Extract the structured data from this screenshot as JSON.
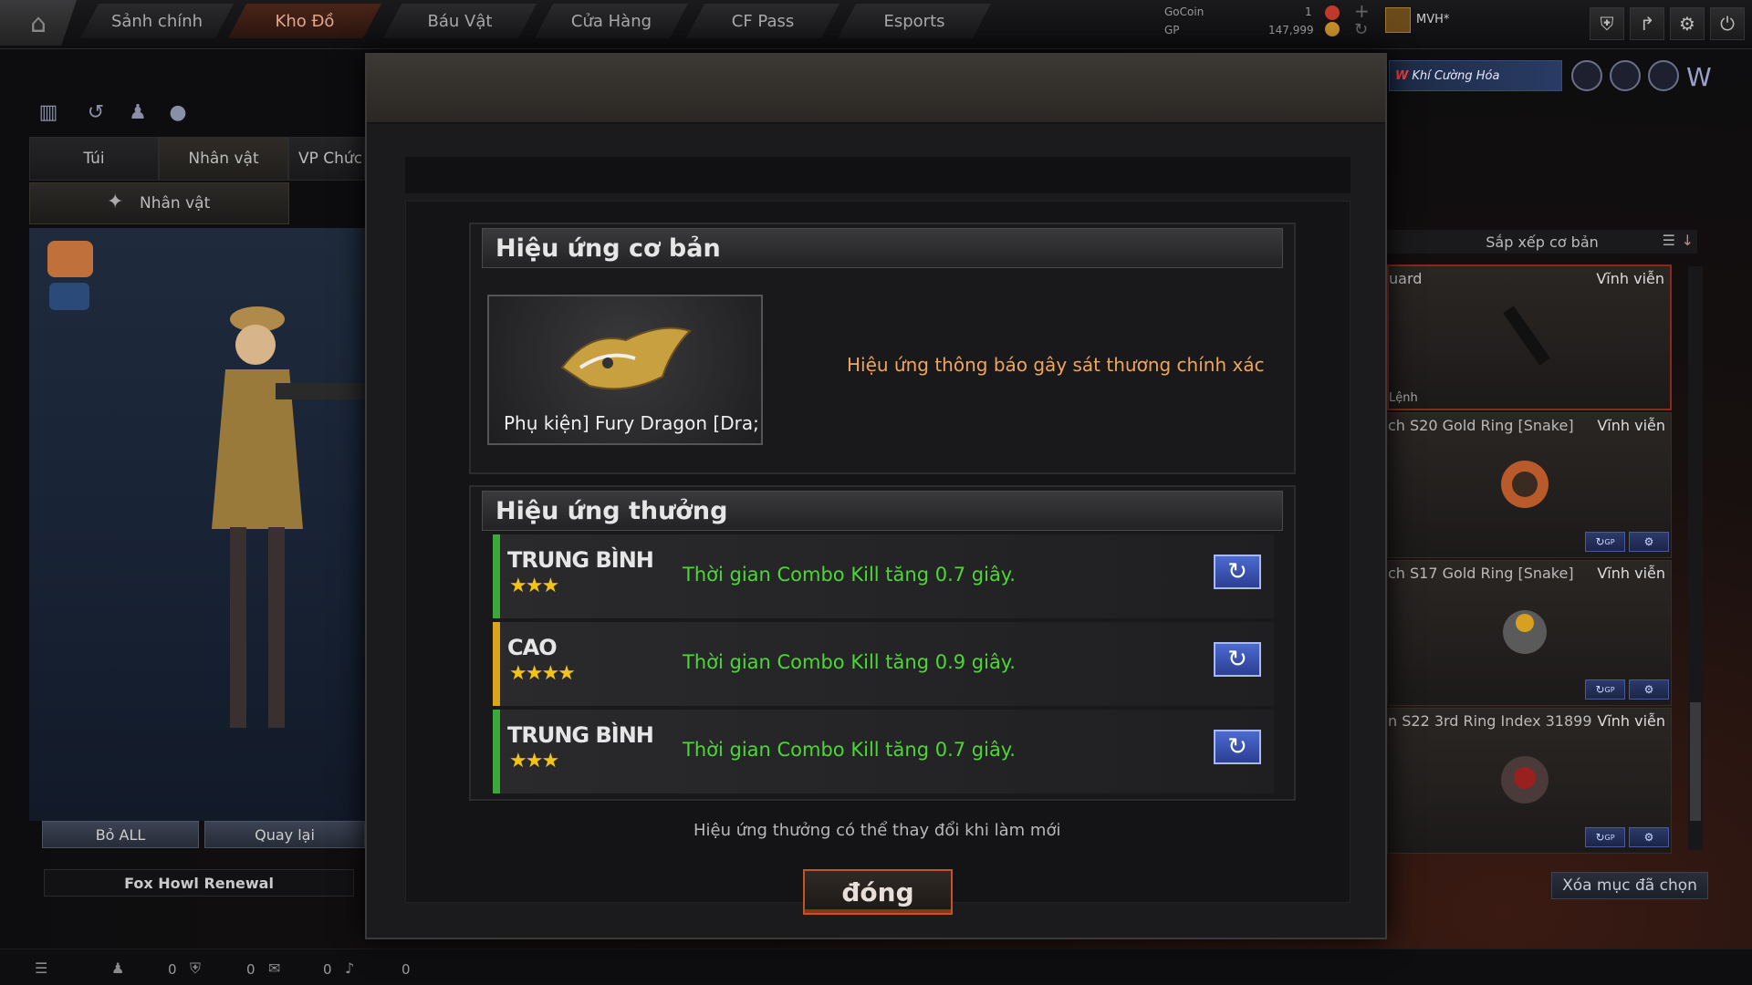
{
  "nav": {
    "home_icon": "home-icon",
    "tabs": [
      {
        "label": "Sảnh chính",
        "active": false
      },
      {
        "label": "Kho Đồ",
        "active": true
      },
      {
        "label": "Báu Vật",
        "active": false
      },
      {
        "label": "Cửa Hàng",
        "active": false
      },
      {
        "label": "CF Pass",
        "active": false
      },
      {
        "label": "Esports",
        "active": false
      }
    ]
  },
  "currency": {
    "gocoin_label": "GoCoin",
    "gocoin_value": "1",
    "gp_label": "GP",
    "gp_value": "147,999",
    "plus": "+",
    "refresh": "↻"
  },
  "user": {
    "name": "MVH*"
  },
  "left": {
    "tabs": [
      "Túi",
      "Nhân vật",
      "VP Chức"
    ],
    "character_button": "Nhân vật",
    "remove_all": "Bỏ ALL",
    "back": "Quay lại",
    "character_name": "Fox Howl Renewal"
  },
  "right": {
    "banner_badge": "W",
    "banner_text": "Khí Cường Hóa",
    "sort_label": "Sắp xếp cơ bản",
    "items": [
      {
        "name": "uard",
        "duration": "Vĩnh viễn",
        "sub": "Lệnh"
      },
      {
        "name": "ch S20 Gold Ring [Snake]",
        "duration": "Vĩnh viễn"
      },
      {
        "name": "ch S17 Gold Ring [Snake]",
        "duration": "Vĩnh viễn"
      },
      {
        "name": "n S22 3rd Ring Index 31899",
        "duration": "Vĩnh viễn"
      }
    ],
    "mini_gp": "GP",
    "clear_selected": "Xóa mục đã chọn"
  },
  "status": {
    "values": [
      "0",
      "0",
      "0",
      "0"
    ]
  },
  "modal": {
    "basic_title": "Hiệu ứng cơ bản",
    "item_name": "Phụ kiện] Fury Dragon [Dra;",
    "basic_effect": "Hiệu ứng thông báo gây sát thương chính xác",
    "bonus_title": "Hiệu ứng thưởng",
    "bonus_rows": [
      {
        "tier": "TRUNG BÌNH",
        "stars": "★★★",
        "text": "Thời gian Combo Kill tăng 0.7 giây.",
        "color": "#3da83a"
      },
      {
        "tier": "CAO",
        "stars": "★★★★",
        "text": "Thời gian Combo Kill tăng 0.9 giây.",
        "color": "#d8a51c"
      },
      {
        "tier": "TRUNG BÌNH",
        "stars": "★★★",
        "text": "Thời gian Combo Kill tăng 0.7 giây.",
        "color": "#3da83a"
      }
    ],
    "footnote": "Hiệu ứng thưởng có thể thay đổi khi làm mới",
    "close_label": "đóng"
  }
}
